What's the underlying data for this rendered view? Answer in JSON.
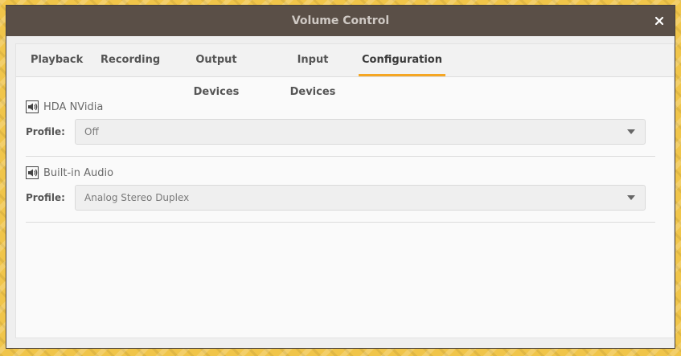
{
  "window": {
    "title": "Volume Control",
    "close_icon": "close-icon"
  },
  "tabs": [
    {
      "label": "Playback"
    },
    {
      "label": "Recording"
    },
    {
      "label": "Output Devices"
    },
    {
      "label": "Input Devices"
    },
    {
      "label": "Configuration",
      "active": true
    }
  ],
  "devices": [
    {
      "name": "HDA NVidia",
      "icon": "speaker-icon",
      "profile_label": "Profile:",
      "profile_value": "Off"
    },
    {
      "name": "Built-in Audio",
      "icon": "speaker-icon",
      "profile_label": "Profile:",
      "profile_value": "Analog Stereo Duplex"
    }
  ],
  "colors": {
    "titlebar": "#5a4f47",
    "active_tab_underline": "#f5a623",
    "desktop": "#f0c54a"
  }
}
